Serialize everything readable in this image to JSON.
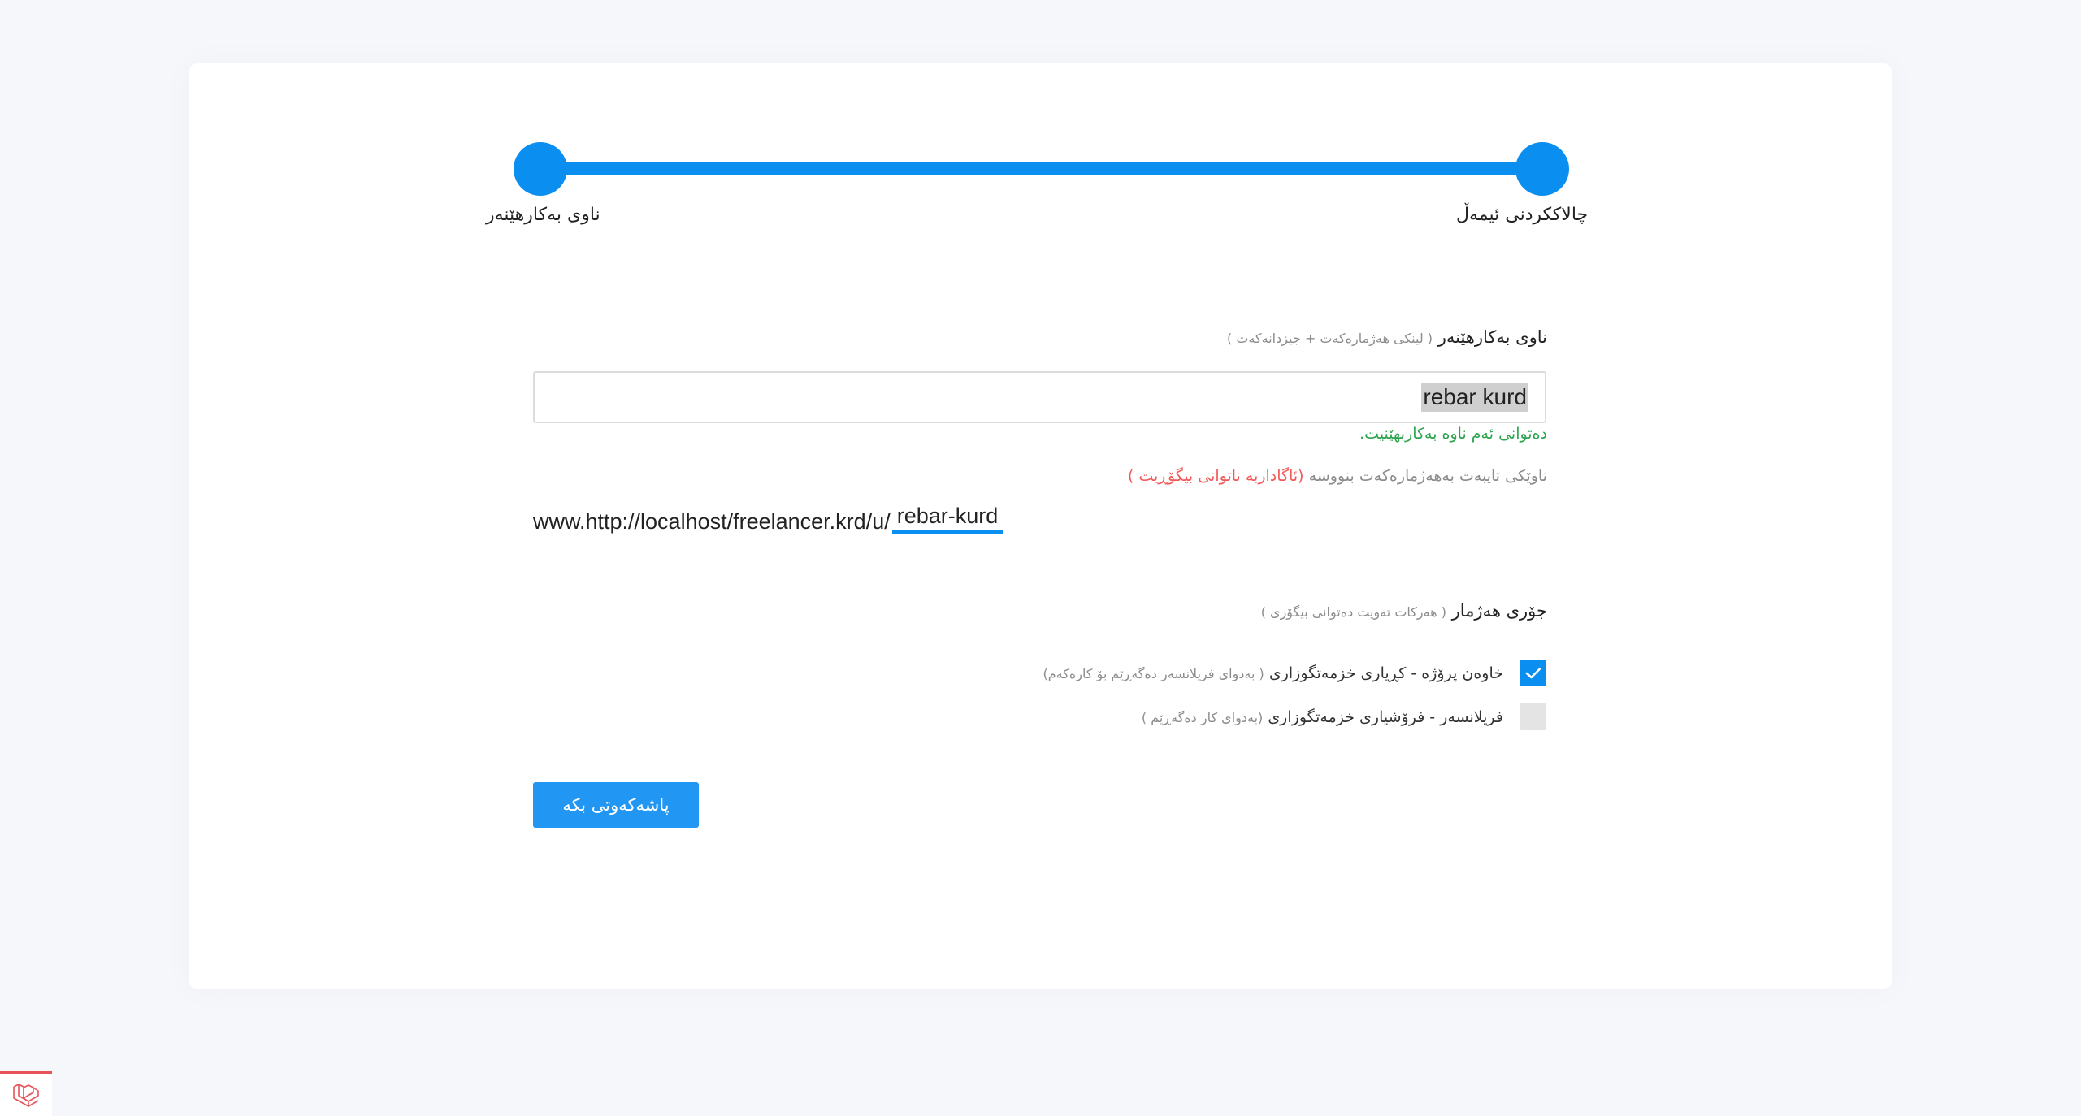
{
  "stepper": {
    "step_left_label": "ناوی بەکارهێنەر",
    "step_right_label": "چالاککردنی ئیمەڵ"
  },
  "username": {
    "label": "ناوی بەکارهێنەر",
    "hint": "( لینکی هەژمارەکەت + جیزدانەکەت )",
    "value": "rebar kurd",
    "available_message": "دەتوانی ئەم ناوە بەکاربهێنیت."
  },
  "url": {
    "hint": "ناوێکی تایبەت بەهەژمارەکەت بنووسە",
    "warning": "(ئاگاداربە ناتوانی بیگۆڕیت )",
    "prefix": "www.http://localhost/freelancer.krd/u/",
    "slug": "rebar-kurd"
  },
  "account_type": {
    "label": "جۆری هەژمار",
    "hint": "( هەرکات تەویت دەتوانی بیگۆری )",
    "options": [
      {
        "label": "خاوەن پرۆژە - کڕیاری خزمەتگوزاری",
        "hint": "( بەدوای فریلانسەر دەگەڕێم بۆ کارەکەم)",
        "checked": true
      },
      {
        "label": "فریلانسەر - فرۆشیاری خزمەتگوزاری",
        "hint": "(بەدوای کار دەگەڕێم )",
        "checked": false
      }
    ]
  },
  "actions": {
    "save_label": "پاشەکەوتی بکە"
  },
  "colors": {
    "accent": "#0a8ef0",
    "success": "#2ea44f",
    "warning": "#f25a5a",
    "button": "#2196f3"
  },
  "icons": {
    "check": "check-icon",
    "badge": "laravel-logo-icon"
  }
}
